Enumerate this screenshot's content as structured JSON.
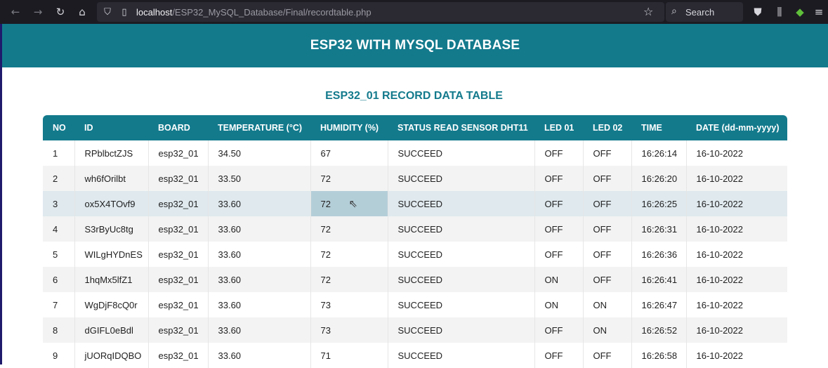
{
  "browser": {
    "url_host": "localhost",
    "url_path": "/ESP32_MySQL_Database/Final/recordtable.php",
    "search_label": "Search",
    "icons": [
      "back-icon",
      "forward-icon",
      "reload-icon",
      "home-icon",
      "shield-icon",
      "page-icon",
      "star-icon",
      "search-icon",
      "pocket-icon",
      "library-icon",
      "extension-icon",
      "menu-icon"
    ]
  },
  "page": {
    "header_title": "ESP32 WITH MYSQL DATABASE",
    "table_title": "ESP32_01 RECORD DATA TABLE"
  },
  "colors": {
    "accent": "#137a8c",
    "hover_row": "#dfe9ee",
    "hover_cell": "#b4ced8"
  },
  "table": {
    "columns": [
      "NO",
      "ID",
      "BOARD",
      "TEMPERATURE (°C)",
      "HUMIDITY (%)",
      "STATUS READ SENSOR DHT11",
      "LED 01",
      "LED 02",
      "TIME",
      "DATE (dd-mm-yyyy)"
    ],
    "rows": [
      [
        "1",
        "RPblbctZJS",
        "esp32_01",
        "34.50",
        "67",
        "SUCCEED",
        "OFF",
        "OFF",
        "16:26:14",
        "16-10-2022"
      ],
      [
        "2",
        "wh6fOrilbt",
        "esp32_01",
        "33.50",
        "72",
        "SUCCEED",
        "OFF",
        "OFF",
        "16:26:20",
        "16-10-2022"
      ],
      [
        "3",
        "ox5X4TOvf9",
        "esp32_01",
        "33.60",
        "72",
        "SUCCEED",
        "OFF",
        "OFF",
        "16:26:25",
        "16-10-2022"
      ],
      [
        "4",
        "S3rByUc8tg",
        "esp32_01",
        "33.60",
        "72",
        "SUCCEED",
        "OFF",
        "OFF",
        "16:26:31",
        "16-10-2022"
      ],
      [
        "5",
        "WILgHYDnES",
        "esp32_01",
        "33.60",
        "72",
        "SUCCEED",
        "OFF",
        "OFF",
        "16:26:36",
        "16-10-2022"
      ],
      [
        "6",
        "1hqMx5lfZ1",
        "esp32_01",
        "33.60",
        "72",
        "SUCCEED",
        "ON",
        "OFF",
        "16:26:41",
        "16-10-2022"
      ],
      [
        "7",
        "WgDjF8cQ0r",
        "esp32_01",
        "33.60",
        "73",
        "SUCCEED",
        "ON",
        "ON",
        "16:26:47",
        "16-10-2022"
      ],
      [
        "8",
        "dGIFL0eBdl",
        "esp32_01",
        "33.60",
        "73",
        "SUCCEED",
        "OFF",
        "ON",
        "16:26:52",
        "16-10-2022"
      ],
      [
        "9",
        "jUORqIDQBO",
        "esp32_01",
        "33.60",
        "71",
        "SUCCEED",
        "OFF",
        "OFF",
        "16:26:58",
        "16-10-2022"
      ]
    ]
  }
}
